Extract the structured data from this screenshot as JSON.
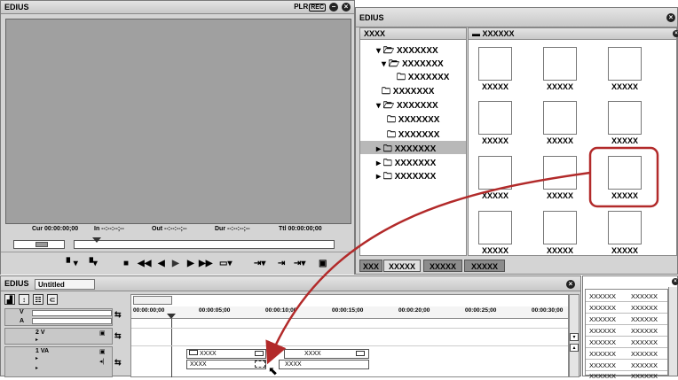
{
  "player": {
    "title": "EDIUS",
    "plr_label": "PLR",
    "rec_label": "REC",
    "timecodes": {
      "cur": "Cur 00:00:00;00",
      "in": "In --:--:--;--",
      "out": "Out --:--:--;--",
      "dur": "Dur --:--:--;--",
      "ttl": "Ttl 00:00:00;00"
    }
  },
  "bin": {
    "title": "EDIUS",
    "tree_header": "XXXX",
    "folder_header": "XXXXXX",
    "tree": [
      "XXXXXXX",
      "XXXXXXX",
      "XXXXXXX",
      "XXXXXXX",
      "XXXXXXX",
      "XXXXXXX",
      "XXXXXXX",
      "XXXXXXX",
      "XXXXXXX",
      "XXXXXXX"
    ],
    "clips": [
      "XXXXX",
      "XXXXX",
      "XXXXX",
      "XXXXX",
      "XXXXX",
      "XXXXX",
      "XXXXX",
      "XXXXX",
      "XXXXX",
      "XXXXX",
      "XXXXX",
      "XXXXX"
    ],
    "tabs": [
      "XXX",
      "XXXXX",
      "XXXXX",
      "XXXXX"
    ]
  },
  "timeline": {
    "title": "EDIUS",
    "sequence_name": "Untitled",
    "ruler": [
      "00:00:00;00",
      "00:00:05;00",
      "00:00:10;00",
      "00:00:15;00",
      "00:00:20;00",
      "00:00:25;00",
      "00:00:30;00"
    ],
    "tracks": [
      {
        "label": "V",
        "sub": "A"
      },
      {
        "label": "2 V"
      },
      {
        "label": "1 VA"
      }
    ],
    "clips": [
      "XXXX",
      "XXXX",
      "XXXX",
      "XXXX"
    ]
  },
  "info_panel": {
    "rows": [
      [
        "XXXXXX",
        "XXXXXX"
      ],
      [
        "XXXXXX",
        "XXXXXX"
      ],
      [
        "XXXXXX",
        "XXXXXX"
      ],
      [
        "XXXXXX",
        "XXXXXX"
      ],
      [
        "XXXXXX",
        "XXXXXX"
      ],
      [
        "XXXXXX",
        "XXXXXX"
      ],
      [
        "XXXXXX",
        "XXXXXX"
      ],
      [
        "XXXXXX",
        "XXXXXX"
      ]
    ]
  },
  "colors": {
    "highlight": "#b22a2a",
    "tree_selected": "#b8b8b8",
    "tab_active": "#8c8c8c"
  }
}
